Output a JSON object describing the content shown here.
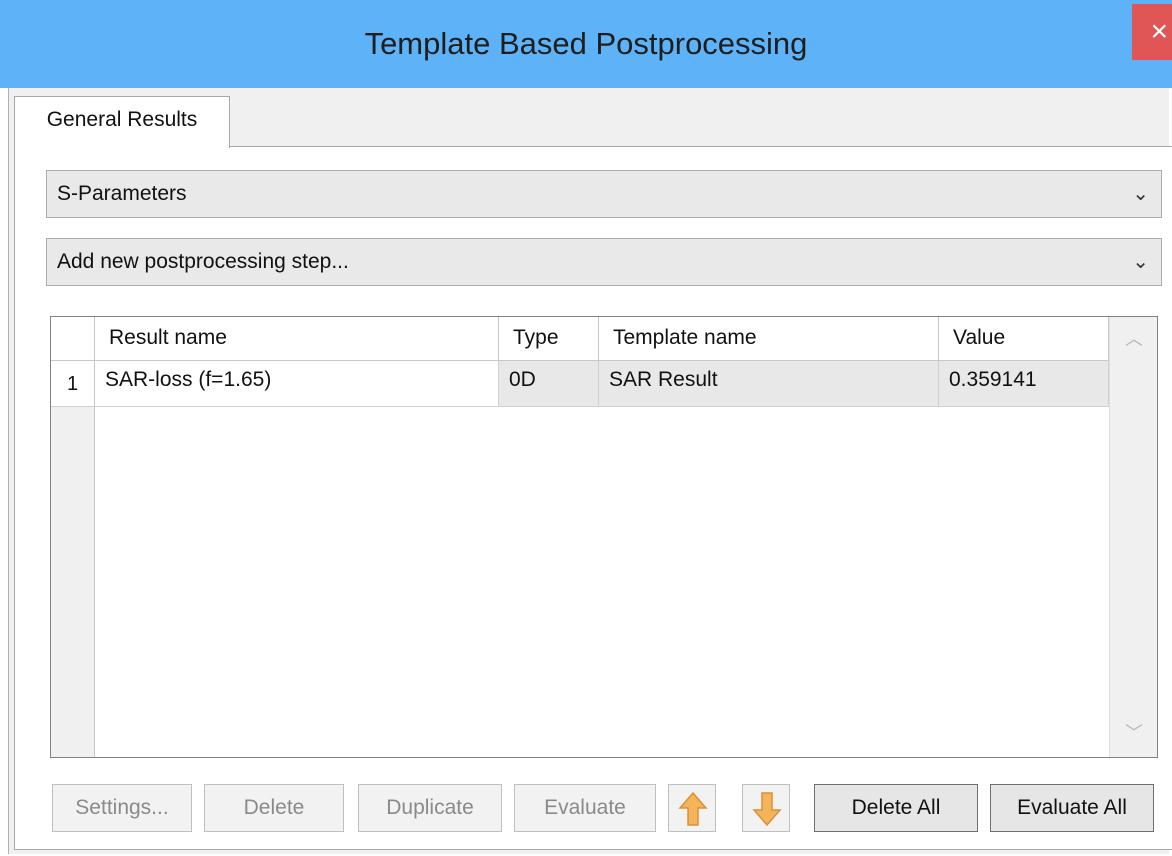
{
  "window": {
    "title": "Template Based Postprocessing",
    "close_glyph": "×"
  },
  "tabs": [
    {
      "label": "General Results"
    }
  ],
  "result_type_combo": {
    "value": "S-Parameters",
    "arrow_glyph": "⌄"
  },
  "add_step_combo": {
    "value": "Add new postprocessing step...",
    "arrow_glyph": "⌄"
  },
  "table": {
    "columns": [
      "Result name",
      "Type",
      "Template name",
      "Value"
    ],
    "rows": [
      {
        "index": "1",
        "result_name": "SAR-loss (f=1.65)",
        "type": "0D",
        "template_name": "SAR Result",
        "value": "0.359141"
      }
    ],
    "scroll_up_glyph": "︿",
    "scroll_down_glyph": "﹀"
  },
  "buttons": {
    "settings": "Settings...",
    "delete": "Delete",
    "duplicate": "Duplicate",
    "evaluate": "Evaluate",
    "delete_all": "Delete All",
    "evaluate_all": "Evaluate All"
  },
  "icons": {
    "move_up": "arrow-up-icon",
    "move_down": "arrow-down-icon",
    "arrow_color": "#f5b35a"
  }
}
